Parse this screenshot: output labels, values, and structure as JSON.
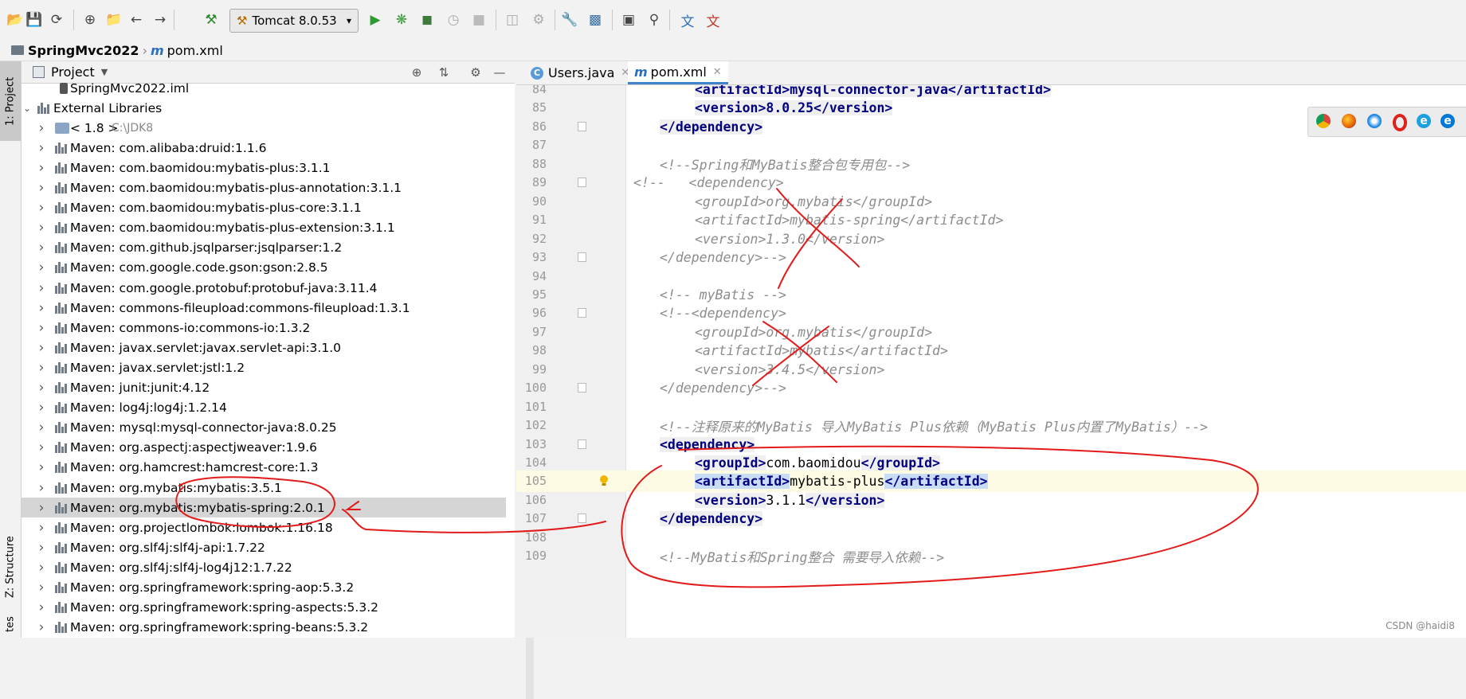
{
  "toolbar": {
    "run_config": "Tomcat 8.0.53",
    "icons": [
      "open-icon",
      "save-icon",
      "sync-icon",
      "add-icon",
      "folder-icon",
      "back-icon",
      "forward-icon",
      "build-icon",
      "run-icon",
      "debug-icon",
      "coverage-icon",
      "profile-icon",
      "stop-icon",
      "attach-icon",
      "deploy-icon",
      "settings-icon",
      "project-structure-icon",
      "terminal-icon",
      "search-icon",
      "translate-icon",
      "translate-alt-icon"
    ]
  },
  "breadcrumb": {
    "project": "SpringMvc2022",
    "file": "pom.xml"
  },
  "left_tabs": {
    "project": "1: Project",
    "structure": "Z: Structure",
    "favorites": "tes"
  },
  "project_panel": {
    "title": "Project",
    "items": [
      {
        "label": "SpringMvc2022.iml",
        "muted": false
      },
      {
        "label": "External Libraries"
      },
      {
        "label": "< 1.8 >",
        "path": "C:\\JDK8"
      },
      {
        "label": "Maven: com.alibaba:druid:1.1.6"
      },
      {
        "label": "Maven: com.baomidou:mybatis-plus:3.1.1"
      },
      {
        "label": "Maven: com.baomidou:mybatis-plus-annotation:3.1.1"
      },
      {
        "label": "Maven: com.baomidou:mybatis-plus-core:3.1.1"
      },
      {
        "label": "Maven: com.baomidou:mybatis-plus-extension:3.1.1"
      },
      {
        "label": "Maven: com.github.jsqlparser:jsqlparser:1.2"
      },
      {
        "label": "Maven: com.google.code.gson:gson:2.8.5"
      },
      {
        "label": "Maven: com.google.protobuf:protobuf-java:3.11.4"
      },
      {
        "label": "Maven: commons-fileupload:commons-fileupload:1.3.1"
      },
      {
        "label": "Maven: commons-io:commons-io:1.3.2"
      },
      {
        "label": "Maven: javax.servlet:javax.servlet-api:3.1.0"
      },
      {
        "label": "Maven: javax.servlet:jstl:1.2"
      },
      {
        "label": "Maven: junit:junit:4.12"
      },
      {
        "label": "Maven: log4j:log4j:1.2.14"
      },
      {
        "label": "Maven: mysql:mysql-connector-java:8.0.25"
      },
      {
        "label": "Maven: org.aspectj:aspectjweaver:1.9.6"
      },
      {
        "label": "Maven: org.hamcrest:hamcrest-core:1.3"
      },
      {
        "label": "Maven: org.mybatis:mybatis:3.5.1"
      },
      {
        "label": "Maven: org.mybatis:mybatis-spring:2.0.1"
      },
      {
        "label": "Maven: org.projectlombok:lombok:1.16.18"
      },
      {
        "label": "Maven: org.slf4j:slf4j-api:1.7.22"
      },
      {
        "label": "Maven: org.slf4j:slf4j-log4j12:1.7.22"
      },
      {
        "label": "Maven: org.springframework:spring-aop:5.3.2"
      },
      {
        "label": "Maven: org.springframework:spring-aspects:5.3.2"
      },
      {
        "label": "Maven: org.springframework:spring-beans:5.3.2"
      }
    ]
  },
  "editor_tabs": [
    {
      "label": "Users.java",
      "active": false
    },
    {
      "label": "pom.xml",
      "active": true
    }
  ],
  "code_lines": [
    {
      "n": "84",
      "text": "<artifactId>mysql-connector-java</artifactId>"
    },
    {
      "n": "85",
      "text": "<version>8.0.25</version>"
    },
    {
      "n": "86",
      "text": "</dependency>"
    },
    {
      "n": "87",
      "text": ""
    },
    {
      "n": "88",
      "text": "<!--Spring和MyBatis整合包专用包-->"
    },
    {
      "n": "89",
      "text": "<!--   <dependency>"
    },
    {
      "n": "90",
      "text": "<groupId>org.mybatis</groupId>"
    },
    {
      "n": "91",
      "text": "<artifactId>mybatis-spring</artifactId>"
    },
    {
      "n": "92",
      "text": "<version>1.3.0</version>"
    },
    {
      "n": "93",
      "text": "</dependency>-->"
    },
    {
      "n": "94",
      "text": ""
    },
    {
      "n": "95",
      "text": "<!-- myBatis -->"
    },
    {
      "n": "96",
      "text": "<!--<dependency>"
    },
    {
      "n": "97",
      "text": "<groupId>org.mybatis</groupId>"
    },
    {
      "n": "98",
      "text": "<artifactId>mybatis</artifactId>"
    },
    {
      "n": "99",
      "text": "<version>3.4.5</version>"
    },
    {
      "n": "100",
      "text": "</dependency>-->"
    },
    {
      "n": "101",
      "text": ""
    },
    {
      "n": "102",
      "text": "<!--注释原来的MyBatis 导入MyBatis Plus依赖（MyBatis Plus内置了MyBatis）-->"
    },
    {
      "n": "103",
      "text": "<dependency>"
    },
    {
      "n": "104",
      "group_open": "<groupId>",
      "group_value": "com.baomidou",
      "group_close": "</groupId>"
    },
    {
      "n": "105",
      "a_open": "<artifactId>",
      "a_value": "mybatis-plus",
      "a_close": "</artifactId>"
    },
    {
      "n": "106",
      "v_open": "<version>",
      "v_value": "3.1.1",
      "v_close": "</version>"
    },
    {
      "n": "107",
      "text": "</dependency>"
    },
    {
      "n": "108",
      "text": ""
    },
    {
      "n": "109",
      "text": "<!--MyBatis和Spring整合 需要导入依赖-->"
    }
  ],
  "browser_icons": [
    "chrome-icon",
    "firefox-icon",
    "safari-icon",
    "opera-icon",
    "ie-icon",
    "edge-icon"
  ],
  "watermark": "CSDN @haidi8",
  "colors": {
    "tag": "#000080",
    "comment": "#8c8c8c",
    "annotation_red": "#e31a1a",
    "selection": "#c9dcf5",
    "current_line": "#fdfbe3"
  }
}
